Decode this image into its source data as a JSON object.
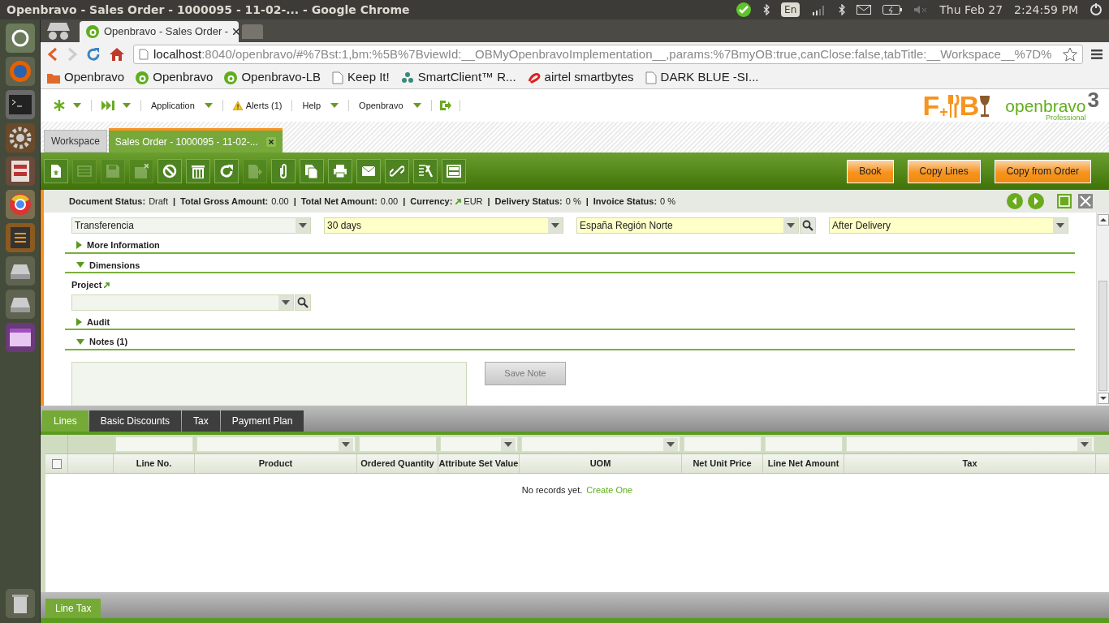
{
  "os_bar": {
    "title": "Openbravo - Sales Order - 1000095 - 11-02-... - Google Chrome",
    "keyboard": "En",
    "date": "Thu Feb 27",
    "time": "2:24:59 PM"
  },
  "browser": {
    "tabs": [
      {
        "label": "Openbravo - Sales Order -",
        "selected": true
      }
    ],
    "url_host": "localhost",
    "url_rest": ":8040/openbravo/#%7Bst:1,bm:%5B%7BviewId:__OBMyOpenbravoImplementation__,params:%7BmyOB:true,canClose:false,tabTitle:__Workspace__%7D%",
    "bookmarks": [
      {
        "kind": "folder",
        "label": "Openbravo"
      },
      {
        "kind": "app",
        "label": "Openbravo"
      },
      {
        "kind": "app",
        "label": "Openbravo-LB"
      },
      {
        "kind": "page",
        "label": "Keep It!"
      },
      {
        "kind": "cluster",
        "label": "SmartClient™ R..."
      },
      {
        "kind": "swoosh",
        "label": "airtel smartbytes"
      },
      {
        "kind": "page",
        "label": "DARK BLUE -SI..."
      }
    ]
  },
  "menu": [
    {
      "kind": "new"
    },
    {
      "kind": "recent"
    },
    {
      "kind": "dropdown",
      "label": "Application"
    },
    {
      "kind": "alert",
      "label": "Alerts (1)"
    },
    {
      "kind": "dropdown",
      "label": "Help"
    },
    {
      "kind": "dropdown",
      "label": "Openbravo"
    },
    {
      "kind": "logout"
    }
  ],
  "restaurant_logo": {
    "first": "F",
    "plus": "+",
    "last": "B"
  },
  "product_logo": {
    "name": "openbravo",
    "version": "3",
    "edition": "Professional"
  },
  "view_tabs": [
    {
      "label": "Workspace",
      "selected": false,
      "closable": false
    },
    {
      "label": "Sales Order - 1000095 - 11-02-...",
      "selected": true,
      "closable": true
    }
  ],
  "toolbar": [
    {
      "kind": "new",
      "disabled": false
    },
    {
      "kind": "grid",
      "disabled": true
    },
    {
      "kind": "save",
      "disabled": true
    },
    {
      "kind": "save-close",
      "disabled": true
    },
    {
      "kind": "cancel",
      "disabled": false
    },
    {
      "kind": "delete",
      "disabled": false
    },
    {
      "kind": "refresh",
      "disabled": false
    },
    {
      "kind": "export",
      "disabled": true
    },
    {
      "kind": "attach",
      "disabled": false
    },
    {
      "kind": "clone",
      "disabled": false
    },
    {
      "kind": "print",
      "disabled": false
    },
    {
      "kind": "email",
      "disabled": false
    },
    {
      "kind": "link",
      "disabled": false
    },
    {
      "kind": "tools",
      "disabled": false
    },
    {
      "kind": "layout",
      "disabled": false
    }
  ],
  "actions": [
    {
      "label": "Book"
    },
    {
      "label": "Copy Lines"
    },
    {
      "label": "Copy from Order"
    }
  ],
  "status": [
    {
      "label": "Document Status:",
      "value": "Draft",
      "linked": false
    },
    {
      "separator": "|",
      "label": "Total Gross Amount:",
      "value": "0.00",
      "linked": false
    },
    {
      "separator": "|",
      "label": "Total Net Amount:",
      "value": "0.00",
      "linked": false
    },
    {
      "separator": "|",
      "label": "Currency:",
      "value": "EUR",
      "linked": true
    },
    {
      "separator": "|",
      "label": "Delivery Status:",
      "value": "0 %",
      "linked": false
    },
    {
      "separator": "|",
      "label": "Invoice Status:",
      "value": "0 %",
      "linked": false
    }
  ],
  "form_row": [
    {
      "value": "Transferencia",
      "required": false,
      "search": false
    },
    {
      "value": "30 days",
      "required": true,
      "search": false
    },
    {
      "value": "España Región Norte",
      "required": true,
      "search": true
    },
    {
      "value": "After Delivery",
      "required": true,
      "search": false
    }
  ],
  "sections": [
    {
      "title": "More Information",
      "expanded": false
    },
    {
      "title": "Dimensions",
      "expanded": true,
      "fields": [
        {
          "label": "Project",
          "linked": true,
          "required": false,
          "search": true
        }
      ]
    },
    {
      "title": "Audit",
      "expanded": false
    },
    {
      "title": "Notes (1)",
      "expanded": true,
      "note_button": {
        "label": "Save Note",
        "disabled": true
      }
    }
  ],
  "sub_tabs": [
    {
      "label": "Lines",
      "selected": true
    },
    {
      "label": "Basic Discounts",
      "selected": false
    },
    {
      "label": "Tax",
      "selected": false
    },
    {
      "label": "Payment Plan",
      "selected": false
    }
  ],
  "grid": {
    "select_all": {
      "checked": false
    },
    "columns": [
      {
        "label": "Line No.",
        "dropdown_filter": false
      },
      {
        "label": "Product",
        "dropdown_filter": true
      },
      {
        "label": "Ordered Quantity",
        "dropdown_filter": false
      },
      {
        "label": "Attribute Set Value",
        "dropdown_filter": true
      },
      {
        "label": "UOM",
        "dropdown_filter": true
      },
      {
        "label": "Net Unit Price",
        "dropdown_filter": false
      },
      {
        "label": "Line Net Amount",
        "dropdown_filter": false
      },
      {
        "label": "Tax",
        "dropdown_filter": true
      }
    ],
    "empty_message": "No records yet.",
    "create_link": "Create One"
  },
  "bottom_tabs": [
    {
      "label": "Line Tax",
      "selected": true
    }
  ]
}
